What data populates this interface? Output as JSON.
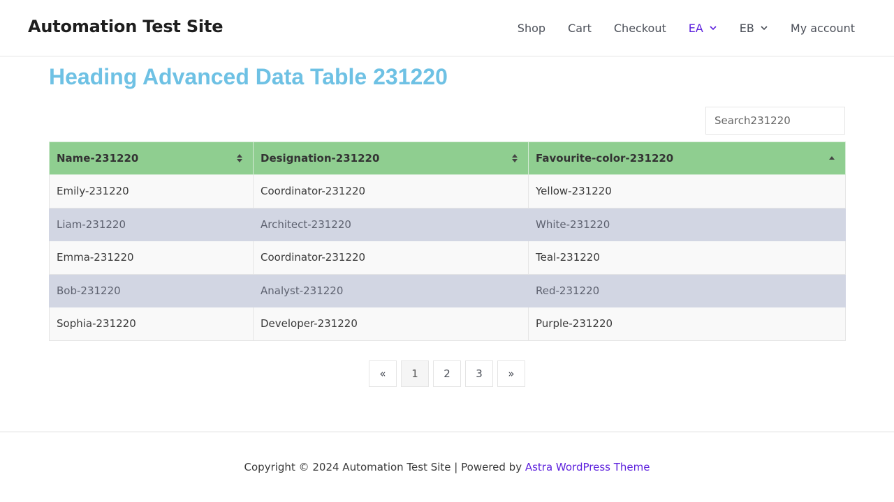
{
  "header": {
    "site_title": "Automation Test Site",
    "nav": [
      {
        "label": "Shop",
        "has_dropdown": false,
        "active": false
      },
      {
        "label": "Cart",
        "has_dropdown": false,
        "active": false
      },
      {
        "label": "Checkout",
        "has_dropdown": false,
        "active": false
      },
      {
        "label": "EA",
        "has_dropdown": true,
        "active": true
      },
      {
        "label": "EB",
        "has_dropdown": true,
        "active": false
      },
      {
        "label": "My account",
        "has_dropdown": false,
        "active": false
      }
    ]
  },
  "main": {
    "heading": "Heading Advanced Data Table 231220",
    "search": {
      "placeholder": "Search231220",
      "value": ""
    },
    "table": {
      "columns": [
        {
          "label": "Name-231220",
          "sort": "both"
        },
        {
          "label": "Designation-231220",
          "sort": "both"
        },
        {
          "label": "Favourite-color-231220",
          "sort": "ascending"
        }
      ],
      "rows": [
        [
          "Emily-231220",
          "Coordinator-231220",
          "Yellow-231220"
        ],
        [
          "Liam-231220",
          "Architect-231220",
          "White-231220"
        ],
        [
          "Emma-231220",
          "Coordinator-231220",
          "Teal-231220"
        ],
        [
          "Bob-231220",
          "Analyst-231220",
          "Red-231220"
        ],
        [
          "Sophia-231220",
          "Developer-231220",
          "Purple-231220"
        ]
      ]
    },
    "pagination": {
      "prev": "«",
      "pages": [
        "1",
        "2",
        "3"
      ],
      "current_page": "1",
      "next": "»"
    }
  },
  "footer": {
    "text": "Copyright © 2024 Automation Test Site | Powered by ",
    "link_text": "Astra WordPress Theme"
  },
  "colors": {
    "heading": "#6ec1e4",
    "table_header_bg": "#8fce90",
    "striped_row_bg": "#d2d6e3",
    "link_accent": "#5e22dd"
  },
  "icons": {
    "dropdown": "chevron-down-icon",
    "sort_both": "sort-both-icon",
    "sort_ascending": "sort-ascending-icon"
  }
}
